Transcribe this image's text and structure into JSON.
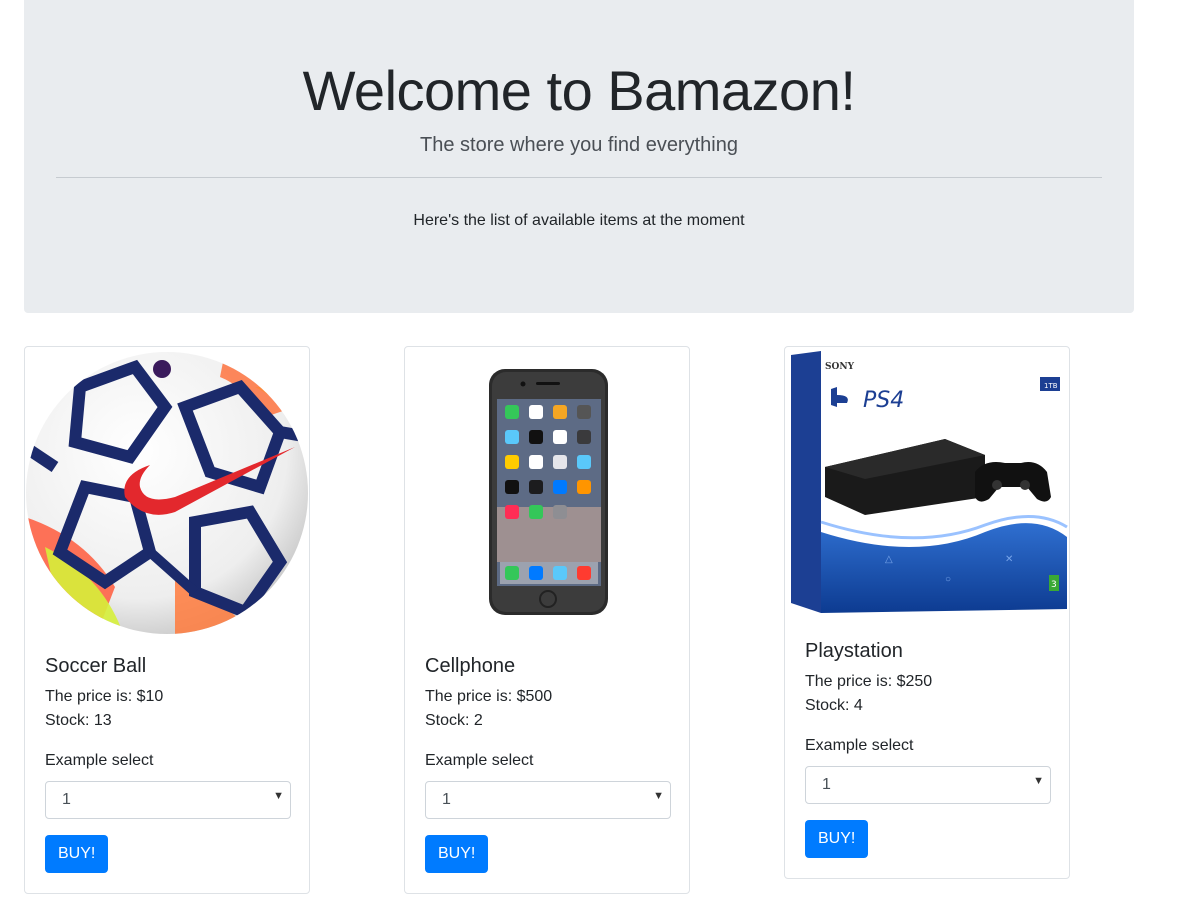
{
  "header": {
    "title": "Welcome to Bamazon!",
    "lead": "The store where you find everything",
    "subtitle": "Here's the list of available items at the moment"
  },
  "products": [
    {
      "name": "Soccer Ball",
      "price": "The price is: $10",
      "stock": "Stock: 13",
      "select_label": "Example select",
      "select_value": "1",
      "buy_label": "BUY!",
      "image": "soccer-ball-image"
    },
    {
      "name": "Cellphone",
      "price": "The price is: $500",
      "stock": "Stock: 2",
      "select_label": "Example select",
      "select_value": "1",
      "buy_label": "BUY!",
      "image": "smartphone-image"
    },
    {
      "name": "Playstation",
      "price": "The price is: $250",
      "stock": "Stock: 4",
      "select_label": "Example select",
      "select_value": "1",
      "buy_label": "BUY!",
      "image": "ps4-box-image",
      "box_text": {
        "brand": "SONY",
        "logo": "PS4",
        "capacity": "1TB",
        "rating": "3"
      }
    }
  ],
  "colors": {
    "primary": "#007bff",
    "jumbotron": "#e9ecef",
    "border": "#dee2e6"
  }
}
